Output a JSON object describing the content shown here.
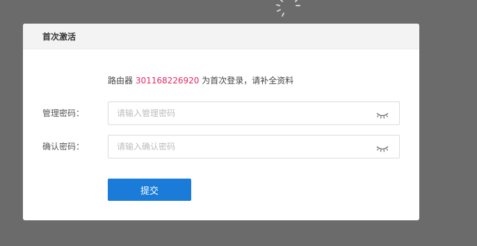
{
  "dialog": {
    "title": "首次激活",
    "notice_prefix": "路由器 ",
    "router_id": "301168226920",
    "notice_suffix": " 为首次登录，请补全资料",
    "accent_color": "#e8255e"
  },
  "form": {
    "admin_password": {
      "label": "管理密码：",
      "placeholder": "请输入管理密码",
      "value": "",
      "toggle_icon": "eye-closed-icon"
    },
    "confirm_password": {
      "label": "确认密码：",
      "placeholder": "请输入确认密码",
      "value": "",
      "toggle_icon": "eye-closed-icon"
    },
    "submit_label": "提交",
    "submit_color": "#1a7bd8"
  },
  "loading_icon": "spinner-icon"
}
